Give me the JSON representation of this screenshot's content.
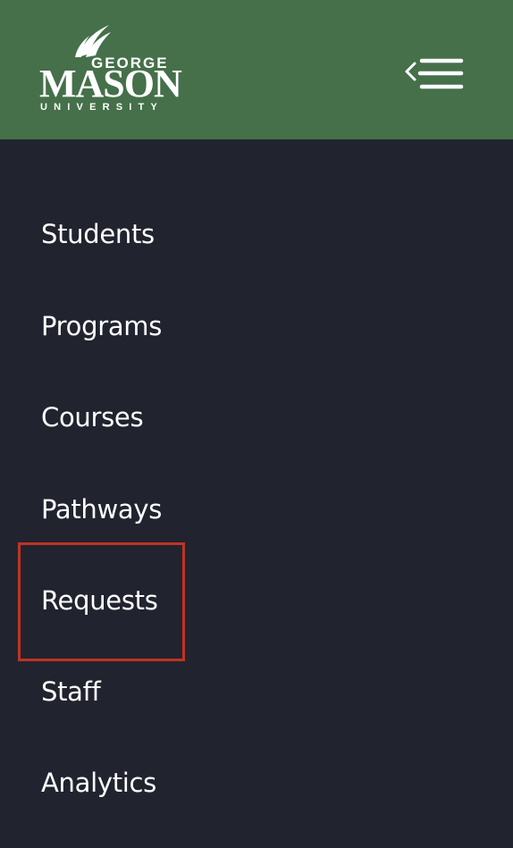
{
  "header": {
    "logo": {
      "line1": "GEORGE",
      "line2": "MASON",
      "line3": "UNIVERSITY"
    },
    "menu_toggle_icon": "collapse-menu-icon",
    "background_color": "#45704a"
  },
  "nav": {
    "background_color": "#21242f",
    "items": [
      {
        "label": "Students"
      },
      {
        "label": "Programs"
      },
      {
        "label": "Courses"
      },
      {
        "label": "Pathways"
      },
      {
        "label": "Requests"
      },
      {
        "label": "Staff"
      },
      {
        "label": "Analytics"
      }
    ]
  },
  "highlight": {
    "target": "Requests",
    "color": "#c03325"
  }
}
